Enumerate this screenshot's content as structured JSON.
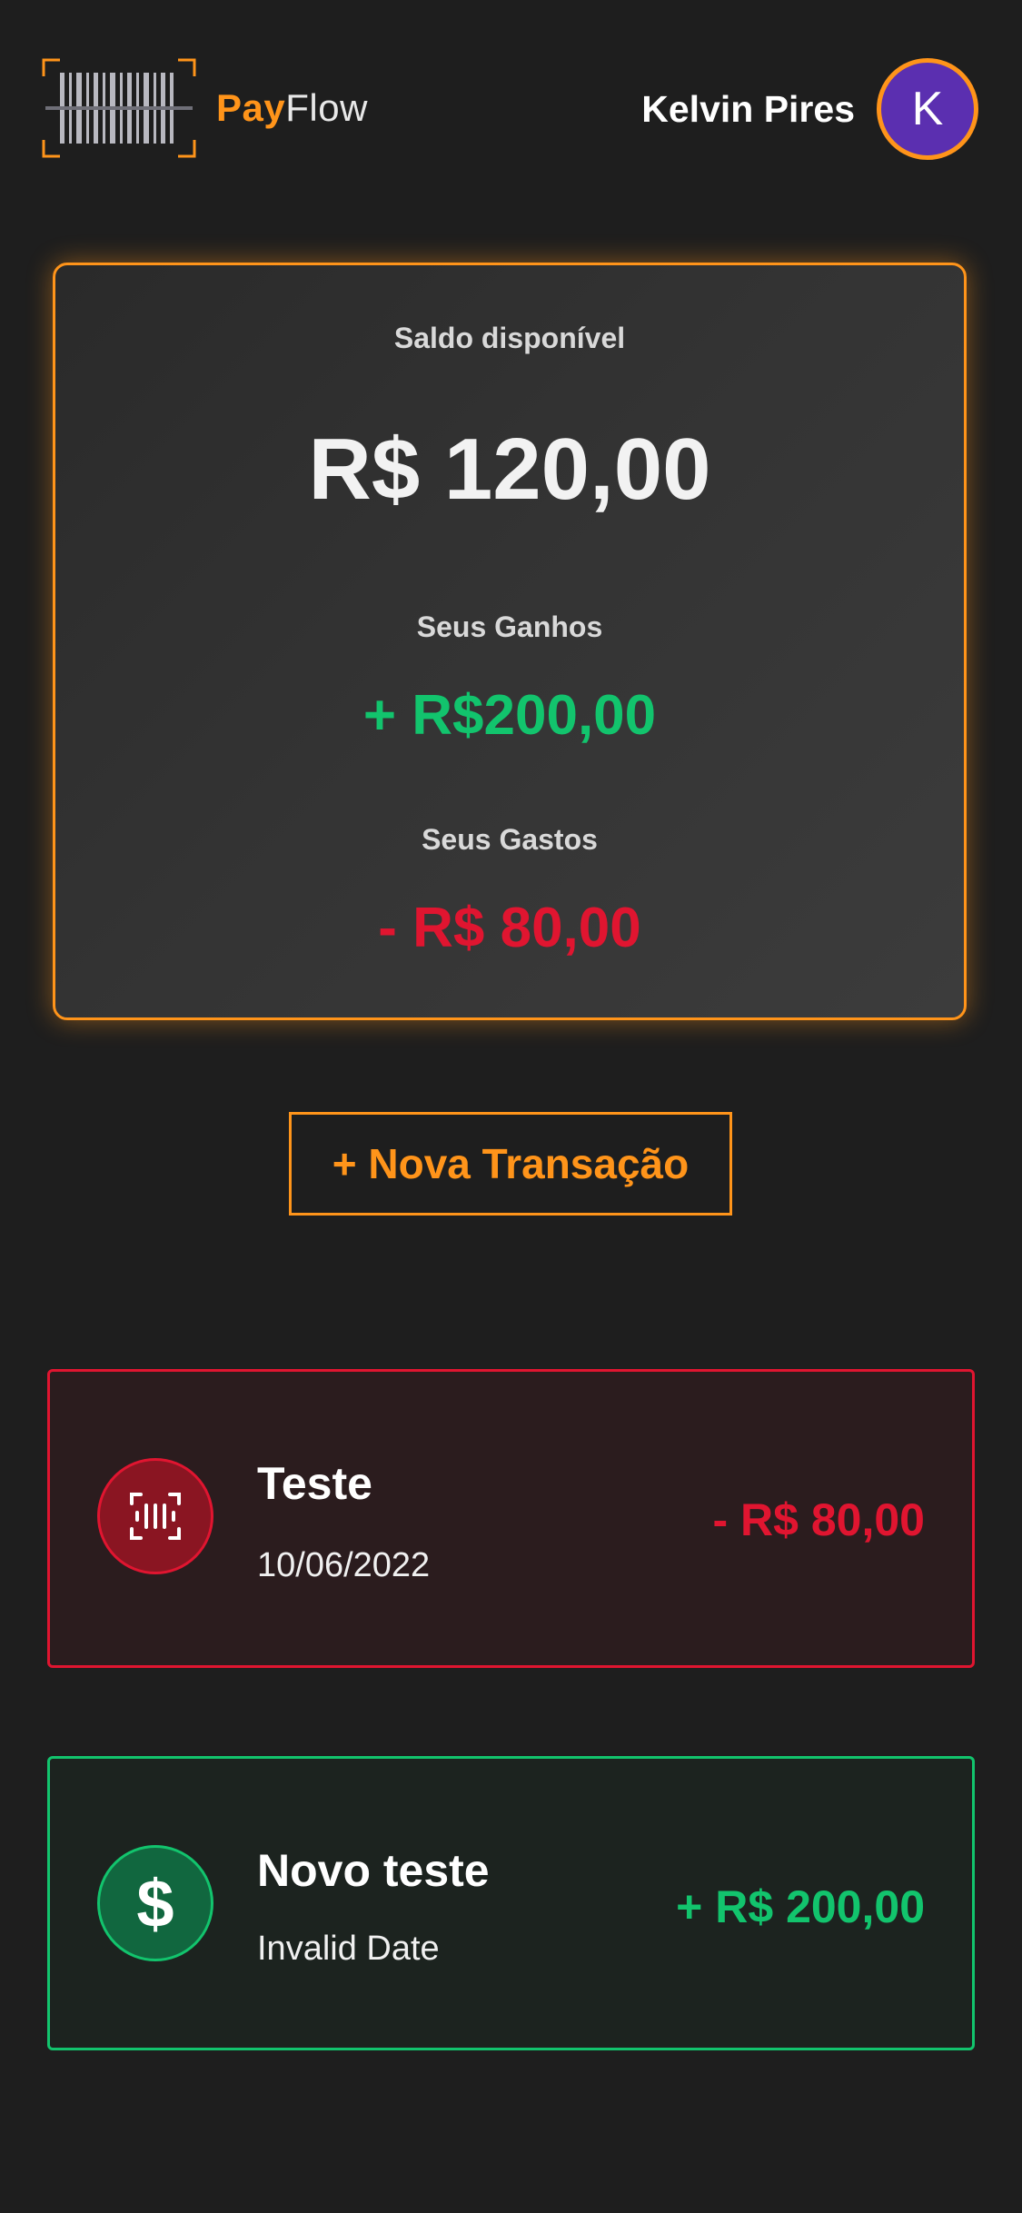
{
  "header": {
    "logo_pay": "Pay",
    "logo_flow": "Flow",
    "user_name": "Kelvin Pires",
    "avatar_initial": "K"
  },
  "balance": {
    "available_label": "Saldo disponível",
    "available_value": "R$ 120,00",
    "income_label": "Seus Ganhos",
    "income_value": "+ R$200,00",
    "expenses_label": "Seus Gastos",
    "expenses_value": "- R$ 80,00"
  },
  "actions": {
    "new_transaction_label": "+ Nova Transação"
  },
  "transactions": [
    {
      "title": "Teste",
      "date": "10/06/2022",
      "amount": "- R$ 80,00",
      "type": "expense",
      "icon": "barcode-scan-icon"
    },
    {
      "title": "Novo teste",
      "date": "Invalid Date",
      "amount": "+ R$ 200,00",
      "type": "income",
      "icon": "dollar-icon",
      "icon_glyph": "$"
    }
  ],
  "colors": {
    "accent": "#ff941a",
    "income": "#12c46d",
    "expense": "#e01530",
    "background": "#1e1e1e",
    "avatar": "#5b2fb0"
  }
}
